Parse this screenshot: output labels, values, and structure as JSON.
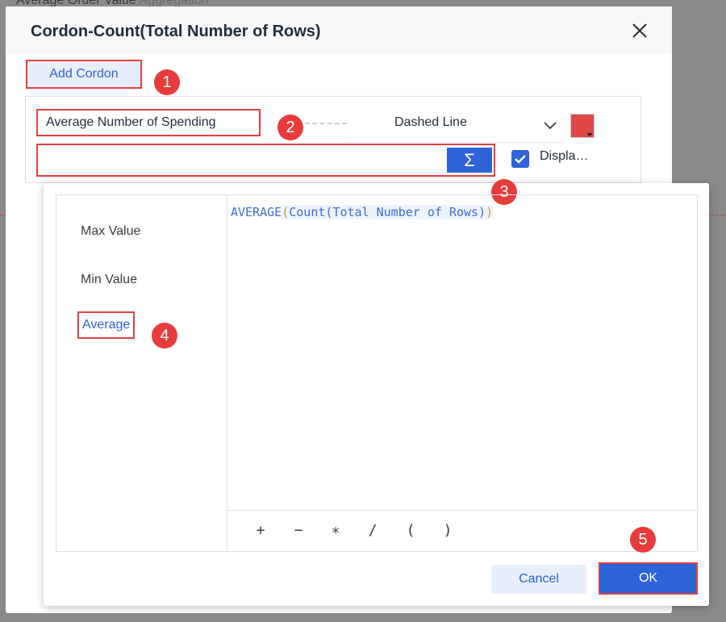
{
  "backdrop": {
    "label": "Average Order Value",
    "label_suffix": "Aggregation"
  },
  "dialog": {
    "title": "Cordon-Count(Total Number of Rows)",
    "close_icon": "close-icon",
    "add_cordon_label": "Add Cordon",
    "cordon": {
      "name_value": "Average Number of Spending",
      "line_style": "Dashed Line",
      "line_style_icon": "chevron-down-icon",
      "color": "#e04848",
      "value_input": "",
      "sigma_label": "Σ",
      "display_checked": true,
      "display_label": "Displa…"
    }
  },
  "formula_panel": {
    "functions": [
      {
        "label": "Max Value"
      },
      {
        "label": "Min Value"
      },
      {
        "label": "Average"
      }
    ],
    "editor": {
      "func": "AVERAGE",
      "open": "(",
      "field": "Count(Total Number of Rows)",
      "close": ")"
    },
    "operators": [
      "+",
      "−",
      "∗",
      "/",
      "(",
      ")"
    ],
    "cancel_label": "Cancel",
    "ok_label": "OK"
  },
  "annotations": [
    "1",
    "2",
    "3",
    "4",
    "5"
  ],
  "colors": {
    "accent": "#2e63d9",
    "highlight_border": "#e04040",
    "badge": "#e83b3b"
  }
}
